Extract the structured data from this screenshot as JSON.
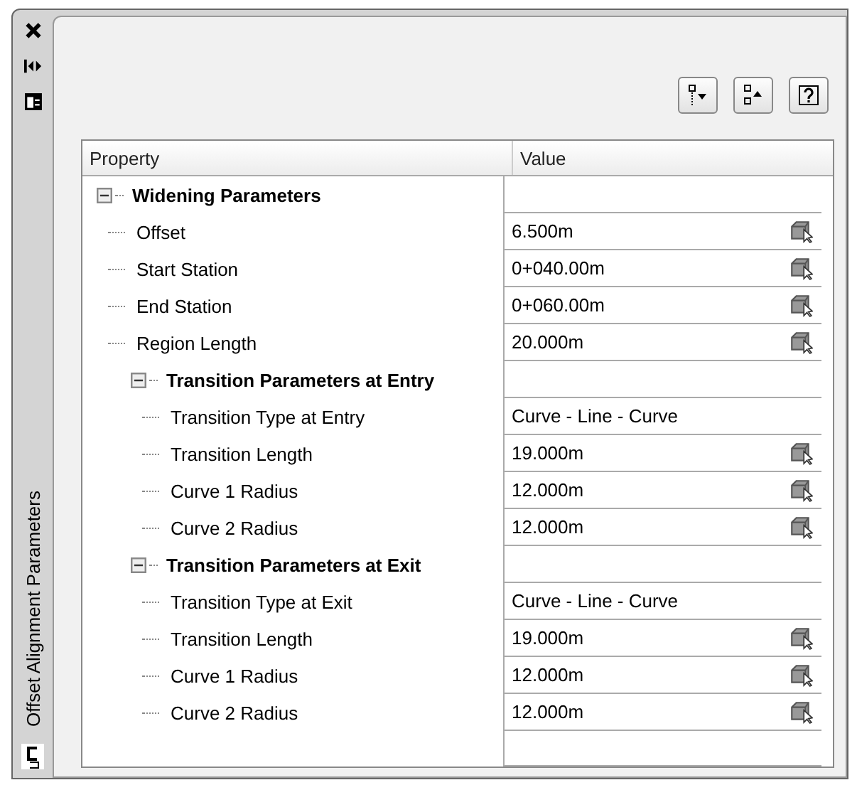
{
  "palette": {
    "title": "Offset Alignment Parameters"
  },
  "table": {
    "columns": [
      "Property",
      "Value"
    ],
    "rows": [
      {
        "kind": "group",
        "label": "Widening Parameters",
        "expanded": true,
        "children": [
          {
            "kind": "property",
            "label": "Offset",
            "value": "6.500m",
            "picker": true
          },
          {
            "kind": "property",
            "label": "Start Station",
            "value": "0+040.00m",
            "picker": true
          },
          {
            "kind": "property",
            "label": "End Station",
            "value": "0+060.00m",
            "picker": true
          },
          {
            "kind": "property",
            "label": "Region Length",
            "value": "20.000m",
            "picker": true
          },
          {
            "kind": "group",
            "label": "Transition Parameters at Entry",
            "expanded": true,
            "children": [
              {
                "kind": "property",
                "label": "Transition Type at Entry",
                "value": "Curve - Line - Curve",
                "picker": false
              },
              {
                "kind": "property",
                "label": "Transition Length",
                "value": "19.000m",
                "picker": true
              },
              {
                "kind": "property",
                "label": "Curve 1 Radius",
                "value": "12.000m",
                "picker": true
              },
              {
                "kind": "property",
                "label": "Curve 2 Radius",
                "value": "12.000m",
                "picker": true
              }
            ]
          },
          {
            "kind": "group",
            "label": "Transition Parameters at Exit",
            "expanded": true,
            "children": [
              {
                "kind": "property",
                "label": "Transition Type at Exit",
                "value": "Curve - Line - Curve",
                "picker": false
              },
              {
                "kind": "property",
                "label": "Transition Length",
                "value": "19.000m",
                "picker": true
              },
              {
                "kind": "property",
                "label": "Curve 1 Radius",
                "value": "12.000m",
                "picker": true
              },
              {
                "kind": "property",
                "label": "Curve 2 Radius",
                "value": "12.000m",
                "picker": true
              }
            ]
          }
        ]
      }
    ]
  }
}
